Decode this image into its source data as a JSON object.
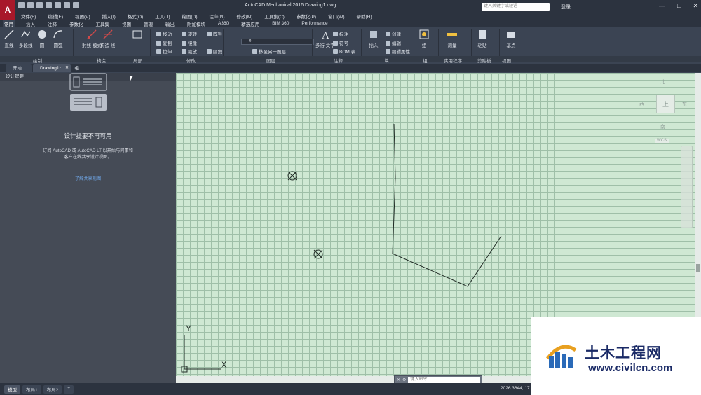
{
  "window": {
    "app_logo": "A",
    "title": "AutoCAD Mechanical 2016     Drawing1.dwg",
    "search_placeholder": "键入关键字或短语",
    "login": "登录",
    "controls": [
      "—",
      "□",
      "✕"
    ]
  },
  "menu": [
    "文件(F)",
    "编辑(E)",
    "视图(V)",
    "插入(I)",
    "格式(O)",
    "工具(T)",
    "绘图(D)",
    "注释(N)",
    "修改(M)",
    "工具集(C)",
    "参数化(P)",
    "窗口(W)",
    "帮助(H)"
  ],
  "ribbon_tabs": [
    "常用",
    "插入",
    "注释",
    "参数化",
    "工具集",
    "视图",
    "管理",
    "输出",
    "附加模块",
    "A360",
    "精选应用",
    "BIM 360",
    "Performance"
  ],
  "ribbon": {
    "draw_tools": [
      "直线",
      "多段线",
      "圆",
      "圆弧"
    ],
    "construct_tools": [
      "射线\n模式",
      "构造\n线"
    ],
    "modify_small": [
      "移动",
      "旋转",
      "阵列",
      "复制",
      "镜像",
      "拉伸",
      "缩放",
      "圆角"
    ],
    "layer_combo": "0",
    "layer_small": [
      "移至另一图层"
    ],
    "annotation": [
      "多行\n文字",
      "标注",
      "符号",
      "BOM 表"
    ],
    "block": [
      "插入",
      "创建",
      "编辑",
      "编辑属性"
    ],
    "group": "组",
    "measure": "测量",
    "paste": "粘贴",
    "base": "基点",
    "panels": [
      "绘制",
      "构造",
      "局部",
      "修改",
      "图层",
      "注释",
      "块",
      "组",
      "实用程序",
      "剪贴板",
      "视图"
    ]
  },
  "doc_tabs": [
    {
      "label": "开始"
    },
    {
      "label": "Drawing1*"
    }
  ],
  "palette": {
    "title": "设计提要",
    "message_title": "设计提要不再可用",
    "message_body": "订阅 AutoCAD 或 AutoCAD LT 以开始与同事和客户在线共享设计视图。",
    "link": "了解共享视图"
  },
  "viewcube": {
    "north": "北",
    "south": "南",
    "east": "东",
    "west": "西",
    "top": "上",
    "wcs": "WCS"
  },
  "ucs": {
    "x": "X",
    "y": "Y"
  },
  "command_line": {
    "placeholder": "键入命令"
  },
  "layout_tabs": [
    "模型",
    "布局1",
    "布局2"
  ],
  "status": {
    "coords": "2026.3644, 17"
  },
  "watermark": {
    "text": "土木工程网",
    "url": "www.civilcn.com"
  },
  "colors": {
    "canvas": "#cfe8d3",
    "grid": "#9fbfa8",
    "accent": "#a8182a",
    "dark_ui": "#2c333f"
  }
}
